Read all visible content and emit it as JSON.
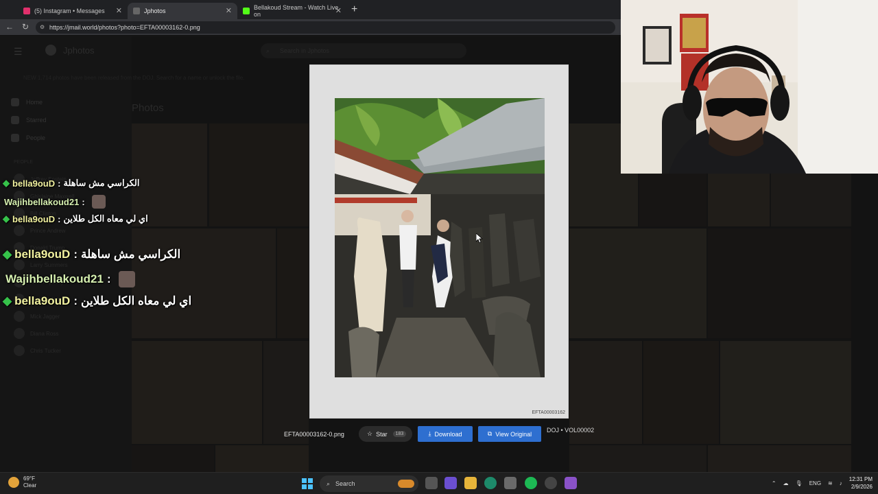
{
  "browser": {
    "tabs": [
      {
        "label": "(5) Instagram • Messages",
        "active": false,
        "icon": "instagram-icon",
        "color": "#e1306c"
      },
      {
        "label": "Jphotos",
        "active": true,
        "icon": "jphotos-icon",
        "color": "#555555"
      },
      {
        "label": "Bellakoud Stream - Watch Live on",
        "active": false,
        "icon": "kick-icon",
        "color": "#53fc18"
      }
    ],
    "url": "https://jmail.world/photos?photo=EFTA00003162-0.png"
  },
  "app": {
    "name": "Jphotos",
    "search_placeholder": "Search in Jphotos",
    "banner": "NEW 1,714 photos have been released from the DOJ. Search for a name or unlock the file.",
    "section_title": "Photos",
    "sidebar": {
      "items": [
        {
          "label": "Home",
          "icon": "home-icon"
        },
        {
          "label": "Starred",
          "icon": "star-icon"
        },
        {
          "label": "People",
          "icon": "people-icon"
        }
      ],
      "people_header": "PEOPLE",
      "people": [
        "Jeffrey Epstein",
        "Ghislaine Maxwell",
        "Bill Clinton",
        "Prince Andrew",
        "Donald Trump",
        "Larry Summers",
        "Kevin Spacey",
        "Michael Jackson",
        "Mick Jagger",
        "Diana Ross",
        "Chris Tucker"
      ]
    }
  },
  "viewer": {
    "photo_id": "EFTA00003162",
    "filename": "EFTA00003162-0.png",
    "star_label": "Star",
    "star_count": "183",
    "download_label": "Download",
    "view_original_label": "View Original",
    "volume": "DOJ • VOL00002"
  },
  "chat": {
    "messages": [
      {
        "user": "bella9ouD",
        "text": "الكراسي مش ساهلة",
        "badge": true
      },
      {
        "user": "Wajihbellakoud21",
        "text": "",
        "badge": false,
        "emote": true
      },
      {
        "user": "bella9ouD",
        "text": "اي لي معاه الكل طلاين",
        "badge": true
      }
    ],
    "separator": ":"
  },
  "taskbar": {
    "weather_temp": "69°F",
    "weather_desc": "Clear",
    "search_label": "Search",
    "lang": "ENG",
    "time": "12:31 PM",
    "date": "2/9/2026"
  }
}
